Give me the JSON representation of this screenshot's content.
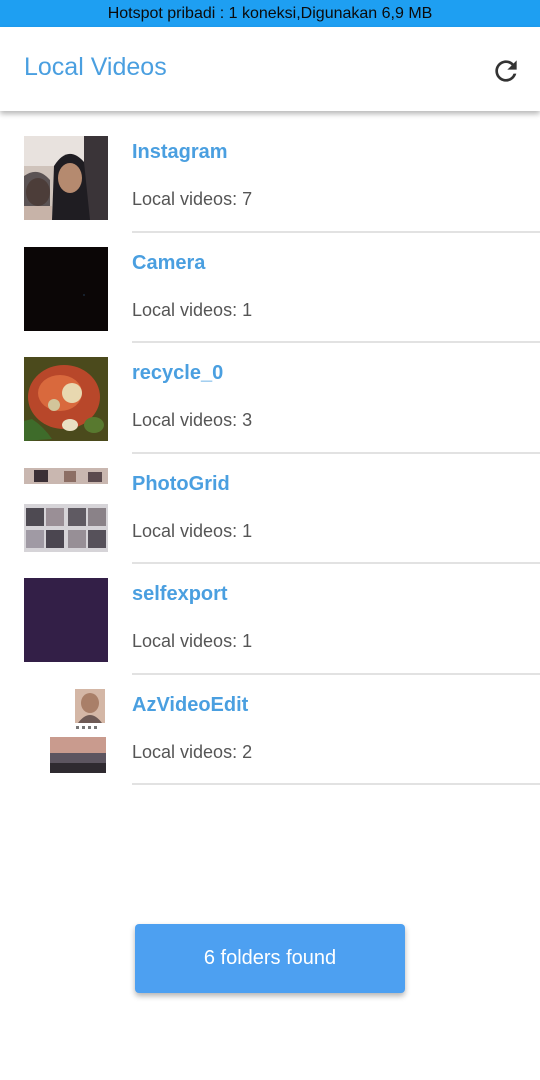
{
  "status_bar": {
    "text": "Hotspot pribadi : 1 koneksi,Digunakan 6,9 MB"
  },
  "app_bar": {
    "title": "Local Videos",
    "refresh_icon": "refresh-icon"
  },
  "folders": [
    {
      "name": "Instagram",
      "count_text": "Local videos: 7"
    },
    {
      "name": "Camera",
      "count_text": "Local videos: 1"
    },
    {
      "name": "recycle_0",
      "count_text": "Local videos: 3"
    },
    {
      "name": "PhotoGrid",
      "count_text": "Local videos: 1"
    },
    {
      "name": "selfexport",
      "count_text": "Local videos: 1"
    },
    {
      "name": "AzVideoEdit",
      "count_text": "Local videos: 2"
    }
  ],
  "snackbar": {
    "text": "6 folders found"
  },
  "colors": {
    "status_bar": "#1e9ff2",
    "accent": "#4a9fe0",
    "snackbar": "#4da0f1"
  }
}
